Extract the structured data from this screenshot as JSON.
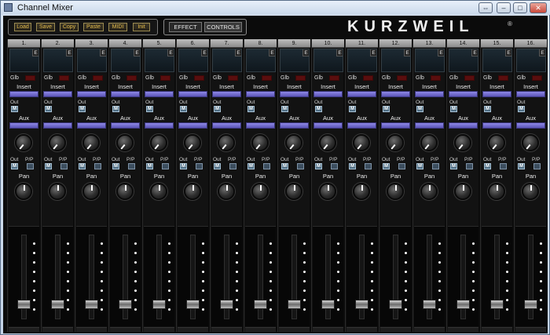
{
  "window": {
    "title": "Channel Mixer"
  },
  "toolbar": {
    "buttons": [
      "Load",
      "Save",
      "Copy",
      "Paste",
      "MIDI",
      "Init"
    ]
  },
  "fx": {
    "effect": "EFFECT",
    "controls": "CONTROLS"
  },
  "brand": {
    "name": "KURZWEIL",
    "mark": "®"
  },
  "strip_labels": {
    "edit": "E",
    "glb": "Glb",
    "insert": "Insert",
    "aux": "Aux",
    "out": "Out",
    "pp": "P/P",
    "mute": "M",
    "pan": "Pan"
  },
  "channels": [
    "1.",
    "2.",
    "3.",
    "4.",
    "5.",
    "6.",
    "7.",
    "8.",
    "9.",
    "10.",
    "11.",
    "12.",
    "13.",
    "14.",
    "15.",
    "16."
  ]
}
